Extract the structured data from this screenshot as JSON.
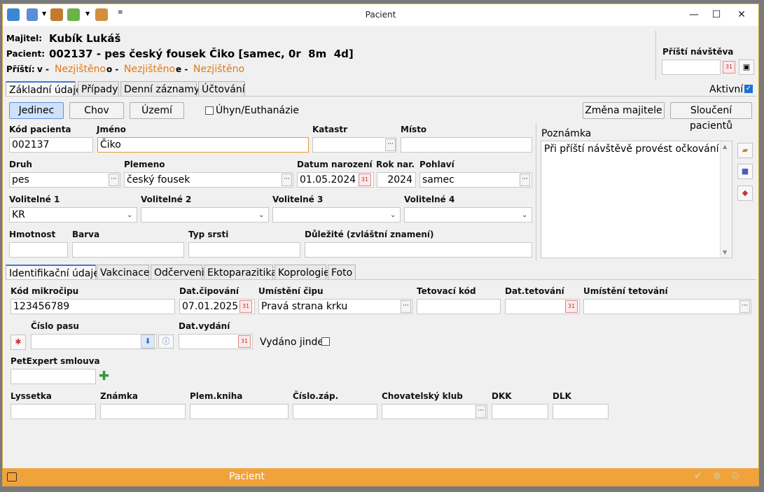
{
  "window": {
    "title": "Pacient"
  },
  "header": {
    "owner_label": "Majitel:",
    "owner_name": "Kubík Lukáš",
    "patient_label": "Pacient:",
    "patient_text": "002137 - pes český fousek Čiko [samec, 0r  8m  4d]",
    "next_label": "Příští:",
    "v_label": "v -",
    "v_value": "Nezjištěno",
    "o_label": "o -",
    "o_value": "Nezjištěno",
    "e_label": "e -",
    "e_value": "Nezjištěno",
    "next_visit_label": "Příští návštěva",
    "next_visit_value": ""
  },
  "main_tabs": [
    "Základní údaje",
    "Případy",
    "Denní záznamy",
    "Účtování"
  ],
  "active_label": "Aktivní",
  "active_checked": true,
  "mode_buttons": [
    "Jedinec",
    "Chov",
    "Území"
  ],
  "death_label": "Úhyn/Euthanázie",
  "change_owner_button": "Změna majitele",
  "merge_button": "Sloučení pacientů",
  "fields": {
    "kod_pacienta": {
      "label": "Kód pacienta",
      "value": "002137"
    },
    "jmeno": {
      "label": "Jméno",
      "value": "Čiko"
    },
    "katastr": {
      "label": "Katastr",
      "value": ""
    },
    "misto": {
      "label": "Místo",
      "value": ""
    },
    "druh": {
      "label": "Druh",
      "value": "pes"
    },
    "plemeno": {
      "label": "Plemeno",
      "value": "český fousek"
    },
    "datum_narozeni": {
      "label": "Datum narození",
      "value": "01.05.2024"
    },
    "rok_nar": {
      "label": "Rok nar.",
      "value": "2024"
    },
    "pohlavi": {
      "label": "Pohlaví",
      "value": "samec"
    },
    "volitelne1": {
      "label": "Volitelné 1",
      "value": "KR"
    },
    "volitelne2": {
      "label": "Volitelné 2",
      "value": ""
    },
    "volitelne3": {
      "label": "Volitelné 3",
      "value": ""
    },
    "volitelne4": {
      "label": "Volitelné 4",
      "value": ""
    },
    "hmotnost": {
      "label": "Hmotnost",
      "value": ""
    },
    "barva": {
      "label": "Barva",
      "value": ""
    },
    "typ_srsti": {
      "label": "Typ srsti",
      "value": ""
    },
    "dulezite": {
      "label": "Důležité (zvláštní znamení)",
      "value": ""
    }
  },
  "note": {
    "label": "Poznámka",
    "value": "Při příští návštěvě provést očkování"
  },
  "sub_tabs": [
    "Identifikační údaje",
    "Vakcinace",
    "Odčerveni",
    "Ektoparazitika",
    "Koprologie",
    "Foto"
  ],
  "ident": {
    "kod_mikrocipu": {
      "label": "Kód mikročipu",
      "value": "123456789"
    },
    "dat_cipovani": {
      "label": "Dat.čipování",
      "value": "07.01.2025"
    },
    "umisteni_cipu": {
      "label": "Umístění čipu",
      "value": "Pravá strana krku"
    },
    "tetovaci_kod": {
      "label": "Tetovací kód",
      "value": ""
    },
    "dat_tetovani": {
      "label": "Dat.tetování",
      "value": ""
    },
    "umisteni_tetovani": {
      "label": "Umístění tetování",
      "value": ""
    },
    "cislo_pasu": {
      "label": "Číslo pasu",
      "value": ""
    },
    "dat_vydani": {
      "label": "Dat.vydání",
      "value": ""
    },
    "vydano_jinde": "Vydáno jinde",
    "petexpert": {
      "label": "PetExpert smlouva",
      "value": ""
    },
    "lyssetka": {
      "label": "Lyssetka",
      "value": ""
    },
    "znamka": {
      "label": "Známka",
      "value": ""
    },
    "plem_kniha": {
      "label": "Plem.kniha",
      "value": ""
    },
    "cislo_zap": {
      "label": "Číslo.záp.",
      "value": ""
    },
    "chovatelsky_klub": {
      "label": "Chovatelský klub",
      "value": ""
    },
    "dkk": {
      "label": "DKK",
      "value": ""
    },
    "dlk": {
      "label": "DLK",
      "value": ""
    }
  },
  "status": {
    "title": "Pacient"
  }
}
